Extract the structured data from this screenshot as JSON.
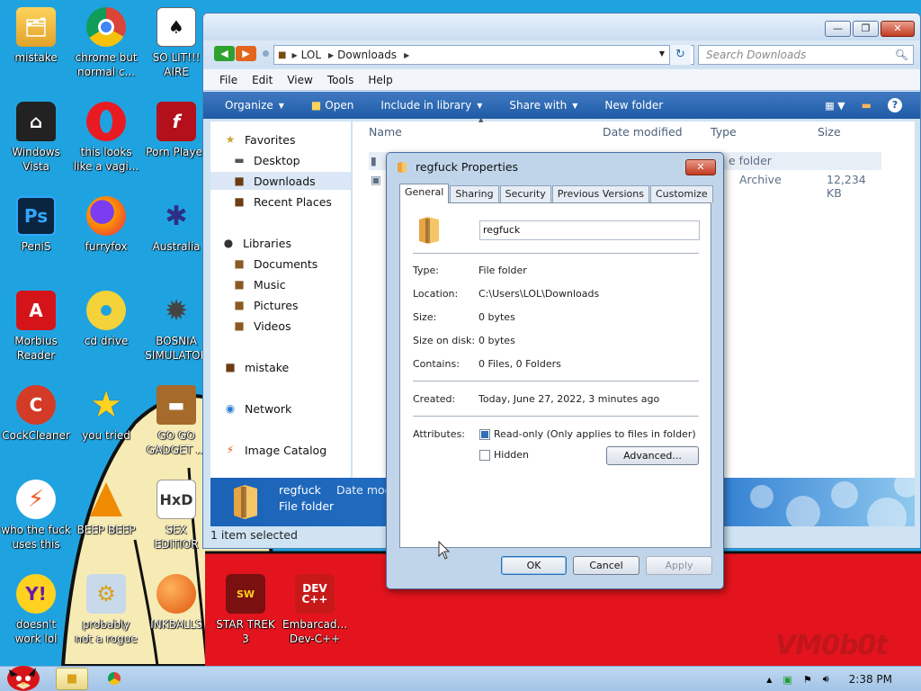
{
  "desktop": {
    "icons": [
      {
        "label": "mistake",
        "icon": "folder-icon"
      },
      {
        "label": "chrome but\nnormal c...",
        "icon": "chrome-icon"
      },
      {
        "label": "SO LIT!!!\nAIRE",
        "icon": "solitaire-icon"
      },
      {
        "label": "Windows\nVista",
        "icon": "recycle-bin-icon"
      },
      {
        "label": "this looks\nlike a vagi...",
        "icon": "opera-icon"
      },
      {
        "label": "Porn Player",
        "icon": "flash-player-icon"
      },
      {
        "label": "PeniS",
        "icon": "photoshop-icon"
      },
      {
        "label": "furryfox",
        "icon": "firefox-icon"
      },
      {
        "label": "Australia",
        "icon": "spider-icon"
      },
      {
        "label": "Morbius\nReader",
        "icon": "acrobat-icon"
      },
      {
        "label": "cd drive",
        "icon": "cd-icon"
      },
      {
        "label": "BOSNIA\nSIMULATOR",
        "icon": "mine-icon"
      },
      {
        "label": "CockCleaner",
        "icon": "ccleaner-icon"
      },
      {
        "label": "you tried",
        "icon": "star-icon"
      },
      {
        "label": "GO GO\nGADGET ...",
        "icon": "briefcase-icon"
      },
      {
        "label": "who the fuck\nuses this",
        "icon": "avast-icon"
      },
      {
        "label": "BEEP BEEP",
        "icon": "vlc-icon"
      },
      {
        "label": "SEX\nEDITIOR",
        "icon": "hxd-icon"
      },
      {
        "label": "doesn't\nwork lol",
        "icon": "yahoo-icon"
      },
      {
        "label": "probably\nnot a rogue",
        "icon": "gears-icon"
      },
      {
        "label": "INKBALLS",
        "icon": "inkball-icon"
      },
      {
        "label": "STAR TREK\n3",
        "icon": "star-wars-icon"
      },
      {
        "label": "Embarcad...\nDev-C++",
        "icon": "devcpp-icon"
      }
    ],
    "wallpaper_text": "VM0b0t"
  },
  "explorer": {
    "window_buttons": {
      "minimize": "—",
      "maximize": "❐",
      "close": "✕"
    },
    "address": {
      "crumbs": [
        "LOL",
        "Downloads"
      ]
    },
    "search_placeholder": "Search Downloads",
    "menu": [
      "File",
      "Edit",
      "View",
      "Tools",
      "Help"
    ],
    "commands": [
      {
        "label": "Organize",
        "dropdown": true
      },
      {
        "label": "Open",
        "dropdown": false
      },
      {
        "label": "Include in library",
        "dropdown": true
      },
      {
        "label": "Share with",
        "dropdown": true
      },
      {
        "label": "New folder",
        "dropdown": false
      }
    ],
    "help": "?",
    "nav": {
      "favorites": "Favorites",
      "favorite_items": [
        "Desktop",
        "Downloads",
        "Recent Places"
      ],
      "libraries": "Libraries",
      "library_items": [
        "Documents",
        "Music",
        "Pictures",
        "Videos"
      ],
      "user": "mistake",
      "network": "Network",
      "image_catalog": "Image Catalog"
    },
    "columns": [
      "Name",
      "Date modified",
      "Type",
      "Size"
    ],
    "rows": [
      {
        "type": "e folder",
        "size": ""
      },
      {
        "type": "Archive",
        "size": "12,234 KB"
      }
    ],
    "details": {
      "name": "regfuck",
      "type": "File folder",
      "modified_label": "Date mod"
    },
    "status": "1 item selected"
  },
  "dialog": {
    "title": "regfuck Properties",
    "close": "✕",
    "tabs": [
      "General",
      "Sharing",
      "Security",
      "Previous Versions",
      "Customize"
    ],
    "name_value": "regfuck",
    "props": [
      {
        "label": "Type:",
        "value": "File folder"
      },
      {
        "label": "Location:",
        "value": "C:\\Users\\LOL\\Downloads"
      },
      {
        "label": "Size:",
        "value": "0 bytes"
      },
      {
        "label": "Size on disk:",
        "value": "0 bytes"
      },
      {
        "label": "Contains:",
        "value": "0 Files, 0 Folders"
      }
    ],
    "created": {
      "label": "Created:",
      "value": "Today, June 27, 2022, 3 minutes ago"
    },
    "attributes_label": "Attributes:",
    "readonly": {
      "label": "Read-only (Only applies to files in folder)",
      "checked": true
    },
    "hidden": {
      "label": "Hidden",
      "checked": false
    },
    "advanced_button": "Advanced...",
    "ok_button": "OK",
    "cancel_button": "Cancel",
    "apply_button": "Apply"
  },
  "taskbar": {
    "clock": "2:38 PM"
  },
  "colors": {
    "desktop": "#1fa3e0",
    "command_bar": "#1f5aa6",
    "wallpaper_red": "#e0101b",
    "wallpaper_yellow": "#f7ebb0"
  }
}
